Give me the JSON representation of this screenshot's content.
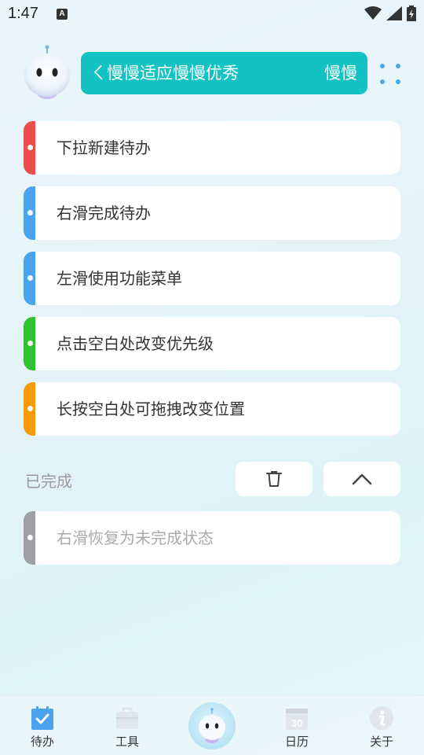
{
  "status_bar": {
    "time": "1:47",
    "notification_icon": "A"
  },
  "header": {
    "mascot_icon": "robot-mascot-icon",
    "banner_text": "长慢慢适应慢慢优秀",
    "banner_text_visible_start": "ㄑ慢慢适应慢慢优秀",
    "banner_text_repeat": "慢慢",
    "banner_color": "#13c2c2",
    "more_icon": "four-dots-icon"
  },
  "todos": [
    {
      "text": "下拉新建待办",
      "color": "#ec4d4d"
    },
    {
      "text": "右滑完成待办",
      "color": "#4aa3ec"
    },
    {
      "text": "左滑使用功能菜单",
      "color": "#4aa3ec"
    },
    {
      "text": "点击空白处改变优先级",
      "color": "#2ec22e"
    },
    {
      "text": "长按空白处可拖拽改变位置",
      "color": "#f59a0a"
    }
  ],
  "completed": {
    "label": "已完成",
    "delete_icon": "trash-icon",
    "collapse_icon": "chevron-up-icon",
    "items": [
      {
        "text": "右滑恢复为未完成状态",
        "color": "#9e9ea8"
      }
    ]
  },
  "nav": {
    "items": [
      {
        "label": "待办",
        "icon": "todo-check-icon",
        "active": true
      },
      {
        "label": "工具",
        "icon": "toolbox-icon",
        "active": false
      },
      {
        "label": "",
        "icon": "robot-mascot-icon",
        "active": false
      },
      {
        "label": "日历",
        "icon": "calendar-icon",
        "calendar_day": "30",
        "active": false
      },
      {
        "label": "关于",
        "icon": "info-icon",
        "active": false
      }
    ],
    "active_color": "#4aa3ec",
    "inactive_color": "#e1e6ea"
  }
}
